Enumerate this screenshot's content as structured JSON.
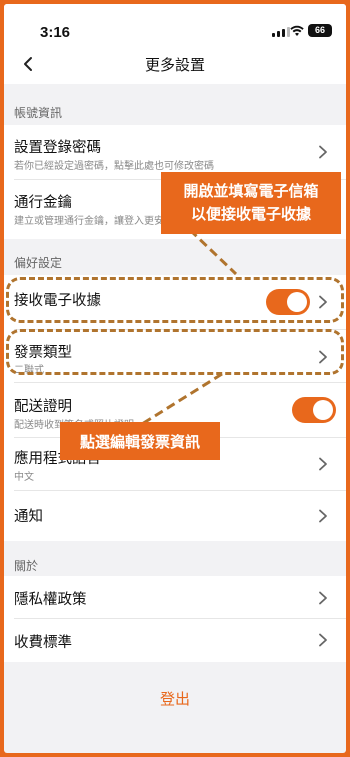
{
  "status": {
    "time": "3:16",
    "battery": "66"
  },
  "nav": {
    "title": "更多設置"
  },
  "sections": {
    "account": "帳號資訊",
    "preferences": "偏好設定",
    "about": "關於"
  },
  "rows": {
    "password": {
      "title": "設置登錄密碼",
      "sub": "若你已經設定過密碼，點擊此處也可修改密碼"
    },
    "passkey": {
      "title": "通行金鑰",
      "sub": "建立或管理通行金鑰，讓登入更安全"
    },
    "receipt": {
      "title": "接收電子收據",
      "enabled": true
    },
    "invoice": {
      "title": "發票類型",
      "sub": "二聯式"
    },
    "delivery": {
      "title": "配送證明",
      "sub": "配送時收到簽名或照片證明",
      "enabled": true
    },
    "language": {
      "title": "應用程式語言",
      "sub": "中文"
    },
    "notify": {
      "title": "通知"
    },
    "privacy": {
      "title": "隱私權政策"
    },
    "fees": {
      "title": "收費標準"
    }
  },
  "logout": "登出",
  "callouts": {
    "top_line1": "開啟並填寫電子信箱",
    "top_line2": "以便接收電子收據",
    "bottom": "點選編輯發票資訊"
  },
  "colors": {
    "accent": "#e8681c",
    "dash": "#b0742e"
  }
}
